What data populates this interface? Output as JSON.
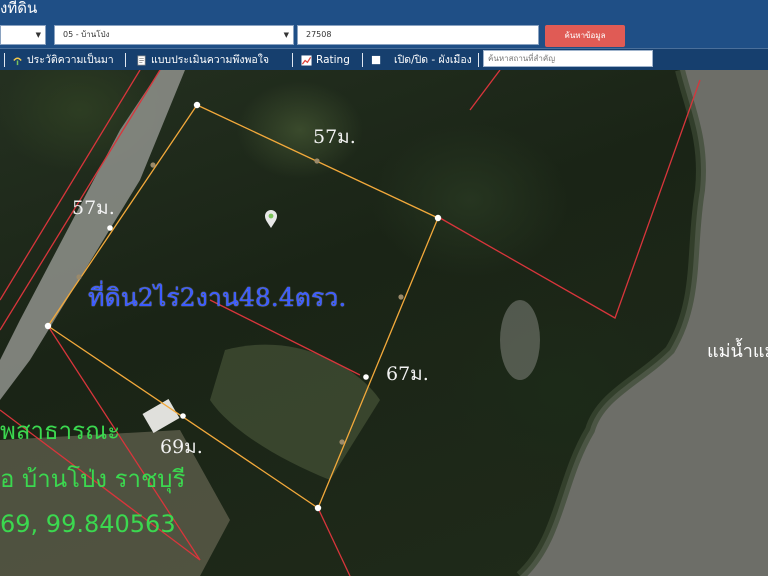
{
  "header": {
    "title_fragment": "งที่ดิน",
    "select_a": "",
    "select_district": "05 - บ้านโป่ง",
    "input_code": "27508",
    "search_button": "ค้นหาข้อมูล"
  },
  "toolbar": {
    "history": "ประวัติความเป็นมา",
    "survey": "แบบประเมินความพึงพอใจ",
    "rating": "Rating",
    "toggle_city_plan": "เปิด/ปิด - ผังเมือง",
    "place_search_placeholder": "ค้นหาสถานที่สำคัญ"
  },
  "map": {
    "parcel_area_label": "ที่ดิน2ไร่2งาน48.4ตรว.",
    "edge_top": "57ม.",
    "edge_left": "57ม.",
    "edge_right": "67ม.",
    "edge_bottom": "69ม.",
    "river_label": "แม่น้ำแม",
    "info_line_1": "พสาธารณะ",
    "info_line_2": "อ บ้านโป่ง ราชบุรี",
    "info_line_3": "69, 99.840563"
  },
  "colors": {
    "header_bg": "#1f4f86",
    "toolbar_bg": "#163f6e",
    "search_button": "#e05b55",
    "parcel_outline": "#f2a93b",
    "cadastral_lines": "#d8353b",
    "area_label": "#3b5bff",
    "info_text": "#3bd84f",
    "river": "#6d6e68"
  },
  "icons": [
    "dropdown-caret-icon",
    "history-icon",
    "document-icon",
    "rating-chart-icon",
    "checkbox-icon",
    "map-pin-icon"
  ]
}
